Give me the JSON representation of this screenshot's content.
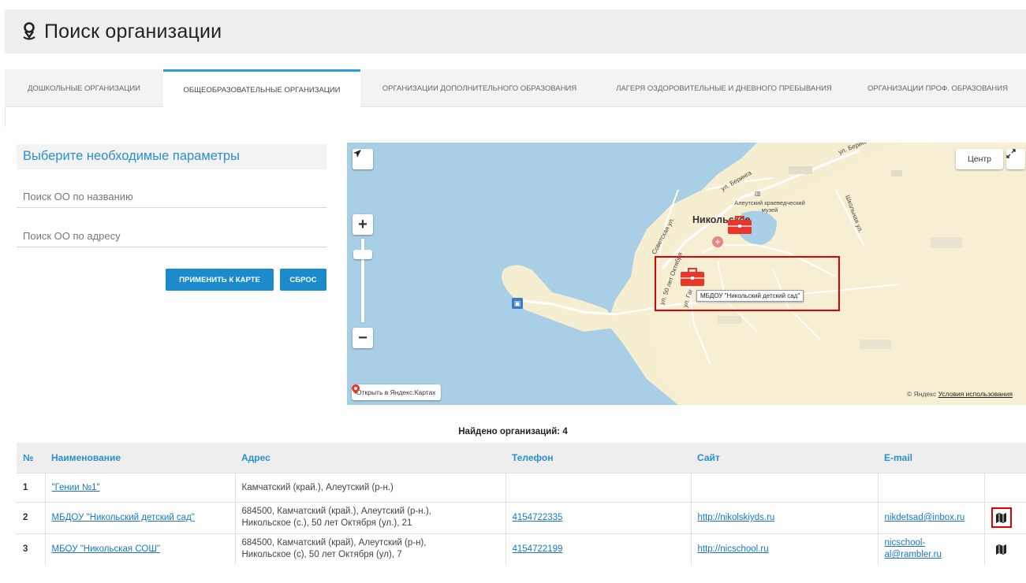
{
  "header": {
    "title": "Поиск организации",
    "icon": "map-pin-icon"
  },
  "tabs": [
    {
      "label": "Дошкольные организации",
      "active": false
    },
    {
      "label": "Общеобразовательные организации",
      "active": true
    },
    {
      "label": "Организации дополнительного образования",
      "active": false
    },
    {
      "label": "Лагеря оздоровительные и дневного пребывания",
      "active": false
    },
    {
      "label": "Организации проф. образования",
      "active": false
    }
  ],
  "filters": {
    "title": "Выберите необходимые параметры",
    "name_placeholder": "Поиск ОО по названию",
    "address_placeholder": "Поиск ОО по адресу",
    "apply_label": "Применить к карте",
    "reset_label": "Сброс"
  },
  "map": {
    "center_button": "Центр",
    "open_link": "Открыть в Яндекс.Картах",
    "copyright_prefix": "© Яндекс",
    "terms_link": "Условия использования",
    "labels": {
      "bering_street": "ул. Беринга",
      "bering_street_2": "ул. Беринга",
      "museum": "Алеутский краеведческий музей",
      "town": "Никольское",
      "sovetskaya": "Советская ул.",
      "shkolnaya": "Школьная ул.",
      "fifty_years": "ул. 50 лет Октября",
      "ga_street": "ул. Гаг"
    },
    "tooltip": "МБДОУ \"Никольский детский сад\"",
    "accent_color": "#e00000"
  },
  "results": {
    "found_label": "Найдено организаций: 4"
  },
  "table": {
    "columns": [
      "№",
      "Наименование",
      "Адрес",
      "Телефон",
      "Сайт",
      "E-mail"
    ],
    "rows": [
      {
        "num": "1",
        "name": "\"Гении №1\"",
        "address_1": "Камчатский (край.), Алеутский (р-н.)",
        "address_2": "",
        "phone": "",
        "site": "",
        "email_1": "",
        "email_2": ""
      },
      {
        "num": "2",
        "name": "МБДОУ \"Никольский детский сад\"",
        "address_1": "684500, Камчатский (край.), Алеутский (р-н.),",
        "address_2": "Никольское (с.), 50 лет Октября (ул.), 21",
        "phone": "4154722335",
        "site": "http://nikolskiyds.ru",
        "email_1": "nikdetsad@inbox.ru",
        "email_2": ""
      },
      {
        "num": "3",
        "name": "МБОУ \"Никольская СОШ\"",
        "address_1": "684500, Камчатский (край), Алеутский (р-н),",
        "address_2": "Никольское (с), 50 лет Октября (ул), 7",
        "phone": "4154722199",
        "site": "http://nicschool.ru",
        "email_1": "nicschool-",
        "email_2": "al@rambler.ru"
      }
    ]
  }
}
